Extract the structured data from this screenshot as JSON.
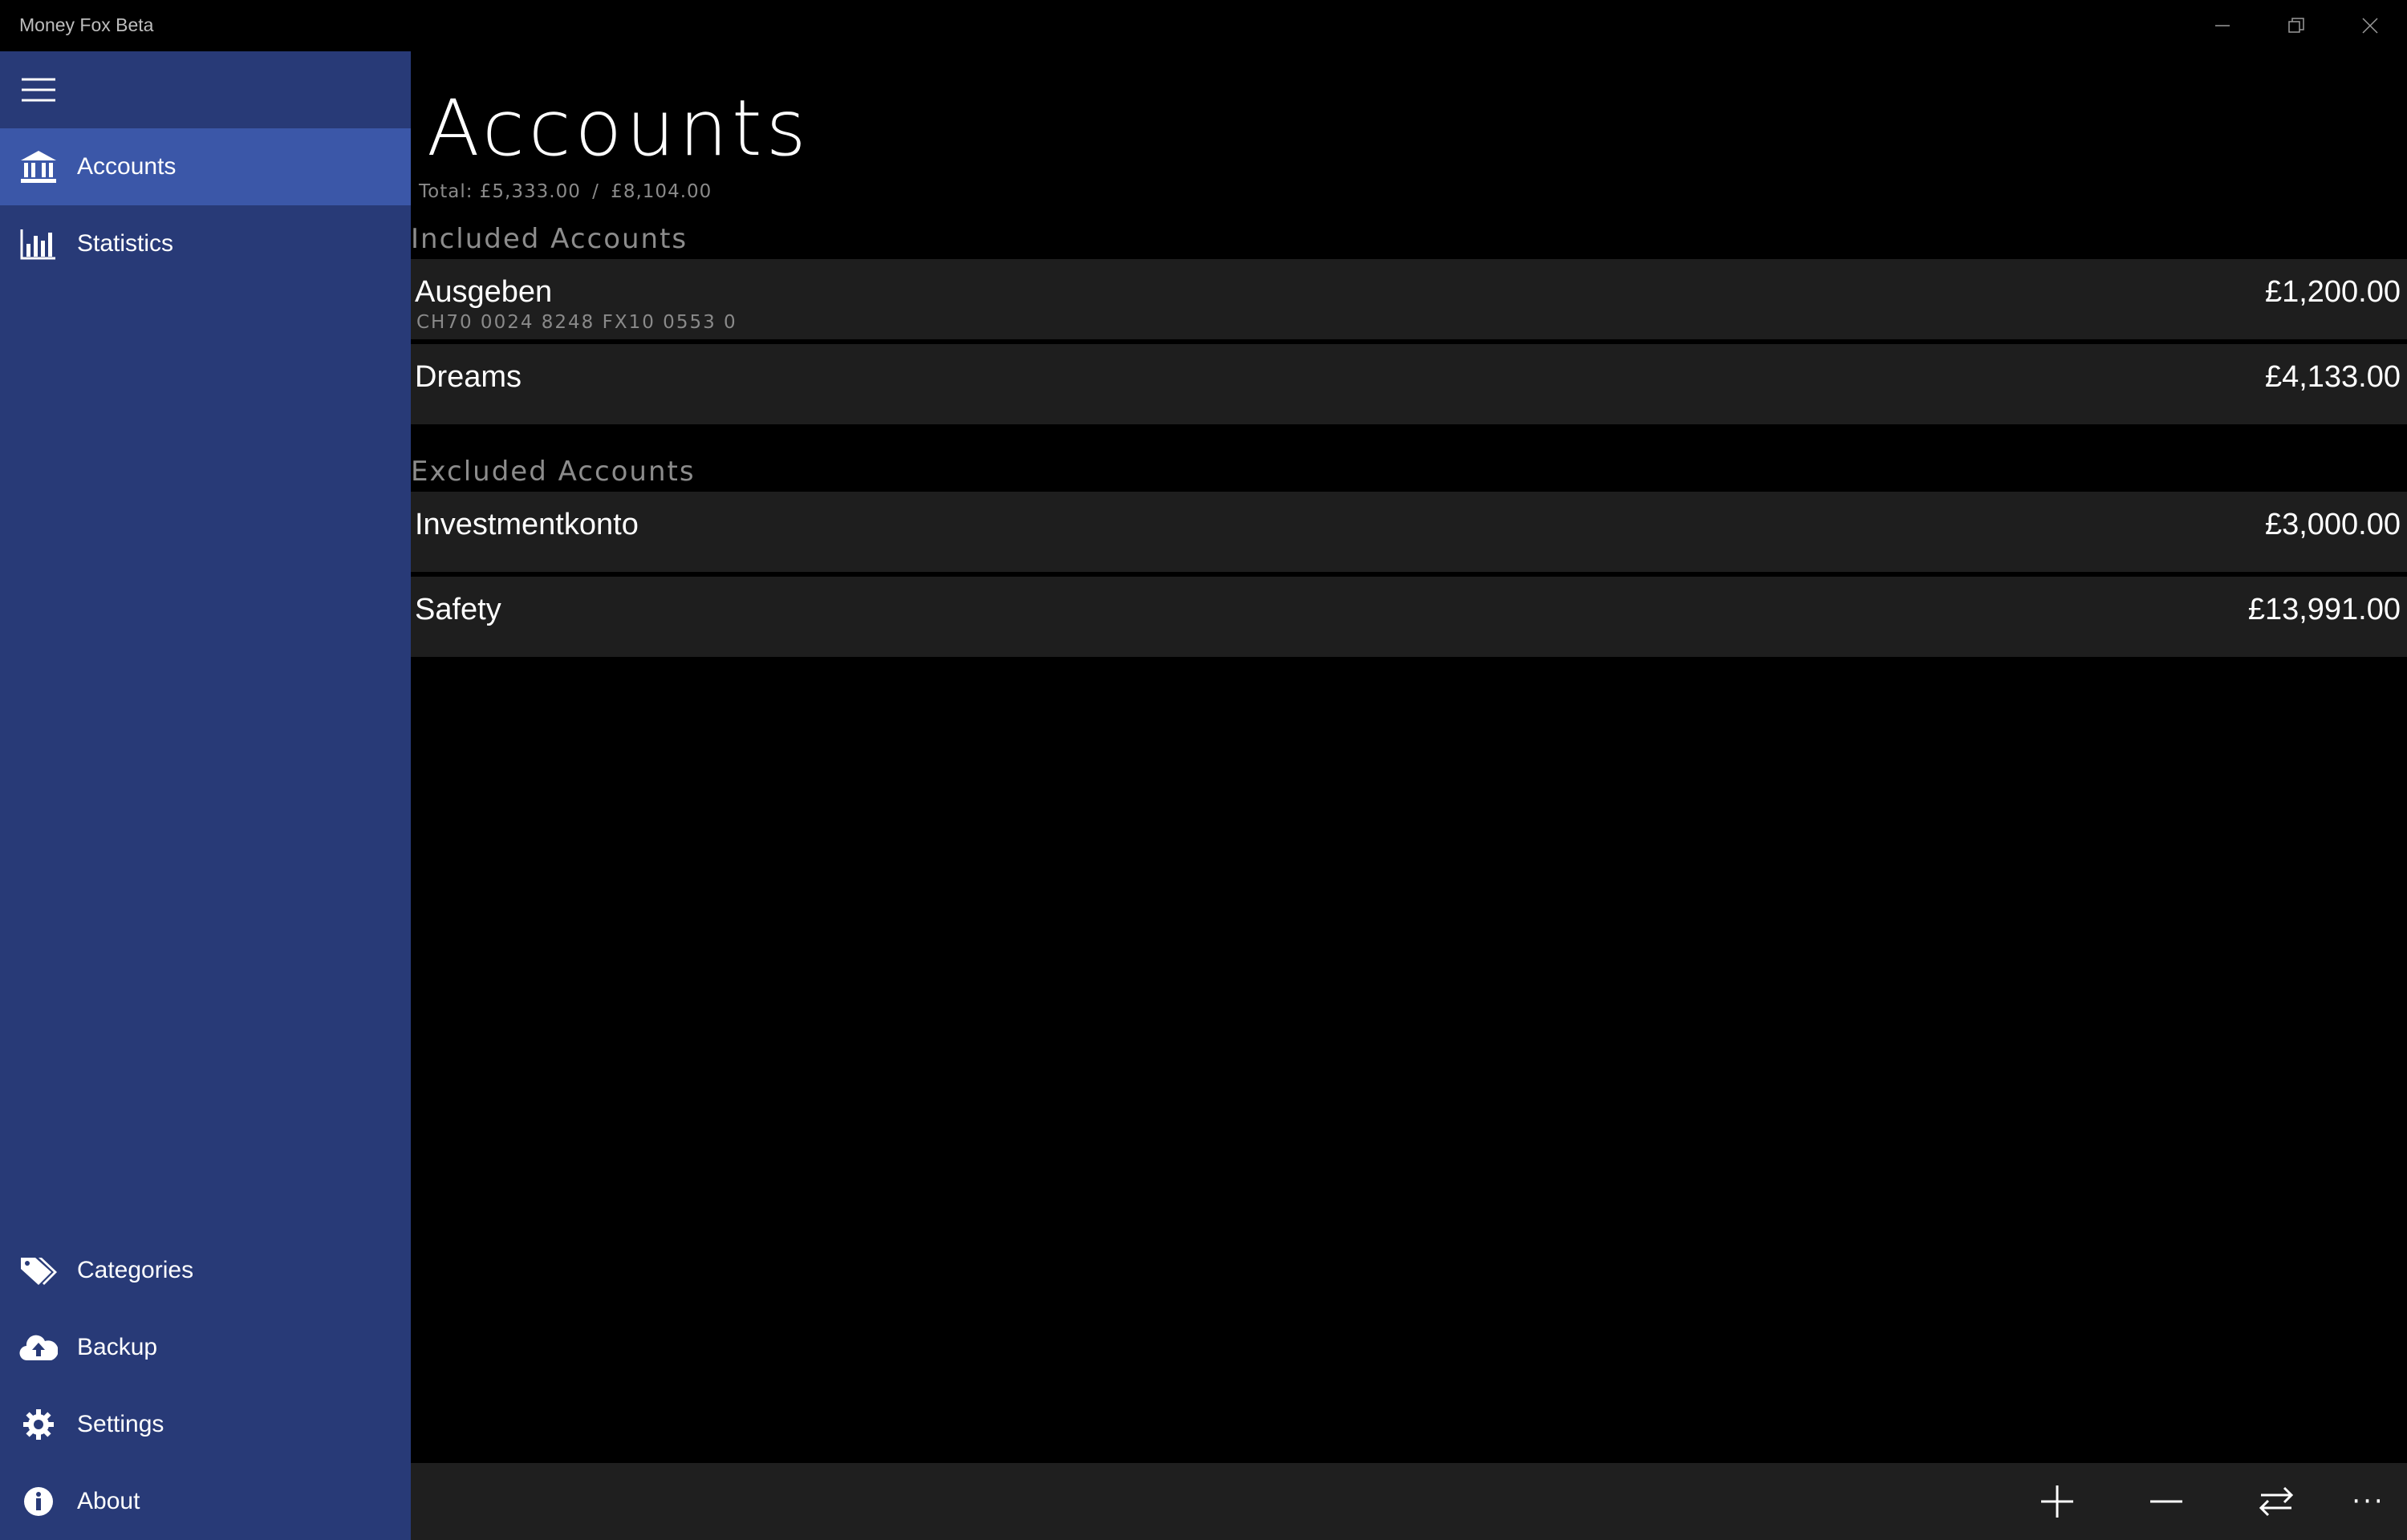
{
  "window": {
    "title": "Money Fox Beta",
    "icons": {
      "minimize": "minimize-icon",
      "restore": "restore-icon",
      "close": "close-icon"
    }
  },
  "sidebar": {
    "background": "#283a77",
    "active_background": "#3b57a8",
    "menu_icon": "hamburger-icon",
    "top_items": [
      {
        "label": "Accounts",
        "icon": "bank-icon",
        "active": true
      },
      {
        "label": "Statistics",
        "icon": "bar-chart-icon",
        "active": false
      }
    ],
    "bottom_items": [
      {
        "label": "Categories",
        "icon": "tags-icon"
      },
      {
        "label": "Backup",
        "icon": "cloud-upload-icon"
      },
      {
        "label": "Settings",
        "icon": "gear-icon"
      },
      {
        "label": "About",
        "icon": "info-icon"
      }
    ]
  },
  "main": {
    "title": "Accounts",
    "total_label": "Total:",
    "total_value": "£5,333.00",
    "total_separator": "/",
    "total_end_value": "£8,104.00",
    "included": {
      "header": "Included Accounts",
      "accounts": [
        {
          "name": "Ausgeben",
          "iban": "CH70 0024 8248 FX10 0553 0",
          "amount": "£1,200.00"
        },
        {
          "name": "Dreams",
          "iban": "",
          "amount": "£4,133.00"
        }
      ]
    },
    "excluded": {
      "header": "Excluded Accounts",
      "accounts": [
        {
          "name": "Investmentkonto",
          "iban": "",
          "amount": "£3,000.00"
        },
        {
          "name": "Safety",
          "iban": "",
          "amount": "£13,991.00"
        }
      ]
    }
  },
  "commandbar": {
    "add_icon": "plus-icon",
    "expense_icon": "minus-icon",
    "transfer_icon": "transfer-icon",
    "more_label": "···"
  }
}
